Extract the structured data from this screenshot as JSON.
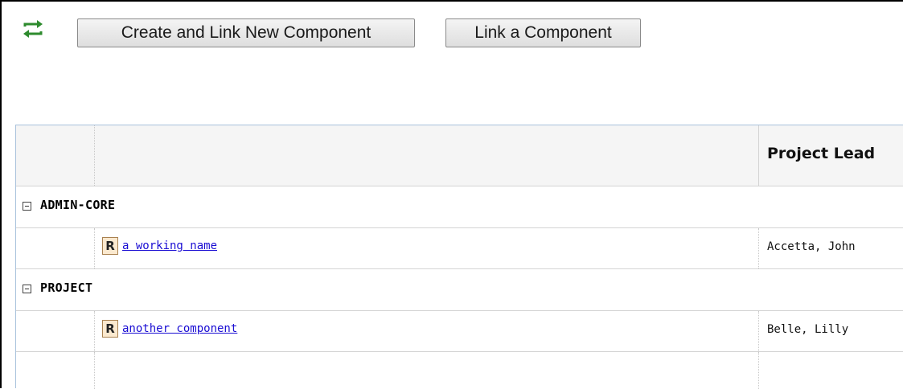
{
  "toolbar": {
    "refresh_icon": "refresh-arrows-icon",
    "create_link_button": "Create and Link New Component",
    "link_button": "Link a Component"
  },
  "grid": {
    "columns": [
      "",
      "",
      "Project Lead"
    ],
    "groups": [
      {
        "name": "ADMIN-CORE",
        "toggle_icon": "collapse-minus-icon",
        "rows": [
          {
            "badge": "R",
            "component": "a working name",
            "project_lead": "Accetta, John"
          }
        ]
      },
      {
        "name": "PROJECT",
        "toggle_icon": "collapse-minus-icon",
        "rows": [
          {
            "badge": "R",
            "component": "another component",
            "project_lead": "Belle, Lilly"
          }
        ]
      }
    ]
  },
  "colors": {
    "icon_green": "#2e8b2e",
    "link_blue": "#1a0dd3",
    "badge_bg": "#fbe9cf",
    "badge_border": "#a98150",
    "grid_border": "#a9c2dc"
  }
}
